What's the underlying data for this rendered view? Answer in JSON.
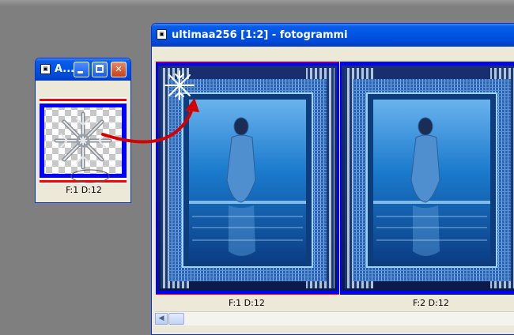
{
  "small_window": {
    "title": "A...",
    "frame_label": "F:1  D:12"
  },
  "big_window": {
    "title": "ultimaa256 [1:2] - fotogrammi",
    "frames": [
      {
        "label": "F:1   D:12"
      },
      {
        "label": "F:2   D:12"
      }
    ]
  },
  "colors": {
    "titlebar": "#0055e5",
    "frame_border": "#0000ff",
    "accent_red": "#ff0000",
    "arrow": "#d40000",
    "sea": "#1a7acc"
  },
  "icons": [
    "app-icon",
    "minimize-icon",
    "maximize-icon",
    "close-icon",
    "snowflake-icon",
    "scroll-left-icon"
  ]
}
